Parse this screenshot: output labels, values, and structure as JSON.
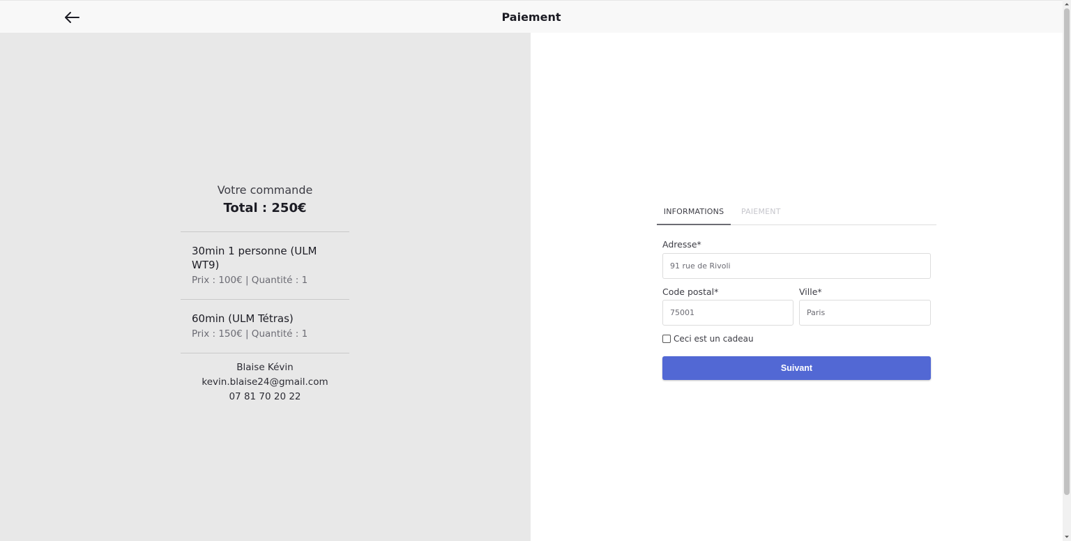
{
  "header": {
    "title": "Paiement",
    "back_icon": "arrow-left-icon"
  },
  "summary": {
    "heading": "Votre commande",
    "total": "Total : 250€",
    "items": [
      {
        "name": "30min 1 personne (ULM WT9)",
        "meta": "Prix : 100€ | Quantité : 1"
      },
      {
        "name": "60min (ULM Tétras)",
        "meta": "Prix : 150€ | Quantité : 1"
      }
    ],
    "customer": {
      "name": "Blaise Kévin",
      "email": "kevin.blaise24@gmail.com",
      "phone": "07 81 70 20 22"
    }
  },
  "tabs": [
    {
      "label": "INFORMATIONS",
      "active": true
    },
    {
      "label": "PAIEMENT",
      "active": false
    }
  ],
  "form": {
    "address_label": "Adresse*",
    "address_value": "91 rue de Rivoli",
    "postal_label": "Code postal*",
    "postal_value": "75001",
    "city_label": "Ville*",
    "city_value": "Paris",
    "gift_label": "Ceci est un cadeau",
    "gift_checked": false,
    "next_label": "Suivant"
  },
  "colors": {
    "accent": "#5268d4",
    "summary_bg": "#e8e8e8",
    "header_bg": "#f8f8f8"
  }
}
